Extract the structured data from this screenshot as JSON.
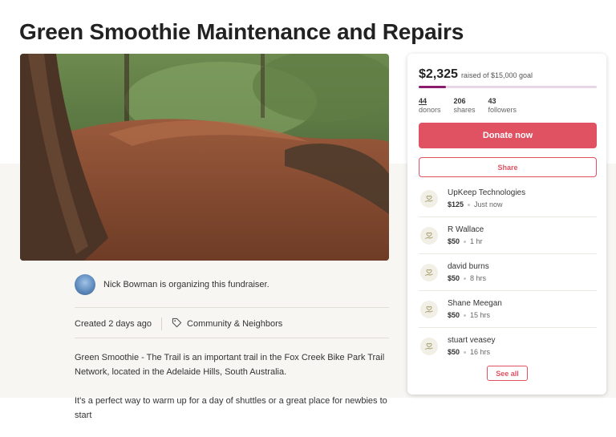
{
  "page": {
    "title": "Green Smoothie Maintenance and Repairs"
  },
  "organizer": {
    "text": "Nick Bowman is organizing this fundraiser."
  },
  "meta": {
    "created": "Created 2 days ago",
    "category": "Community & Neighbors"
  },
  "story": {
    "paragraphs": [
      "Green Smoothie - The Trail is an important trail in the Fox Creek Bike Park Trail Network, located in the Adelaide Hills, South Australia.",
      "It's a perfect way to warm up for a day of shuttles or a great place for newbies to start"
    ]
  },
  "donate_card": {
    "amount": "$2,325",
    "goal_text": "raised of $15,000 goal",
    "progress_fraction": 0.155,
    "stats": [
      {
        "value": "44",
        "label": "donors"
      },
      {
        "value": "206",
        "label": "shares"
      },
      {
        "value": "43",
        "label": "followers"
      }
    ],
    "donate_label": "Donate now",
    "share_label": "Share",
    "see_all_label": "See all",
    "donations": [
      {
        "name": "UpKeep Technologies",
        "amount": "$125",
        "time": "Just now"
      },
      {
        "name": "R Wallace",
        "amount": "$50",
        "time": "1 hr"
      },
      {
        "name": "david burns",
        "amount": "$50",
        "time": "8 hrs"
      },
      {
        "name": "Shane Meegan",
        "amount": "$50",
        "time": "15 hrs"
      },
      {
        "name": "stuart veasey",
        "amount": "$50",
        "time": "16 hrs"
      }
    ]
  },
  "colors": {
    "accent": "#e05162",
    "progress": "#8b1b6b",
    "background": "#f7f6f3"
  },
  "icons": {
    "category": "tag-icon",
    "donation": "heart-hand-icon"
  }
}
